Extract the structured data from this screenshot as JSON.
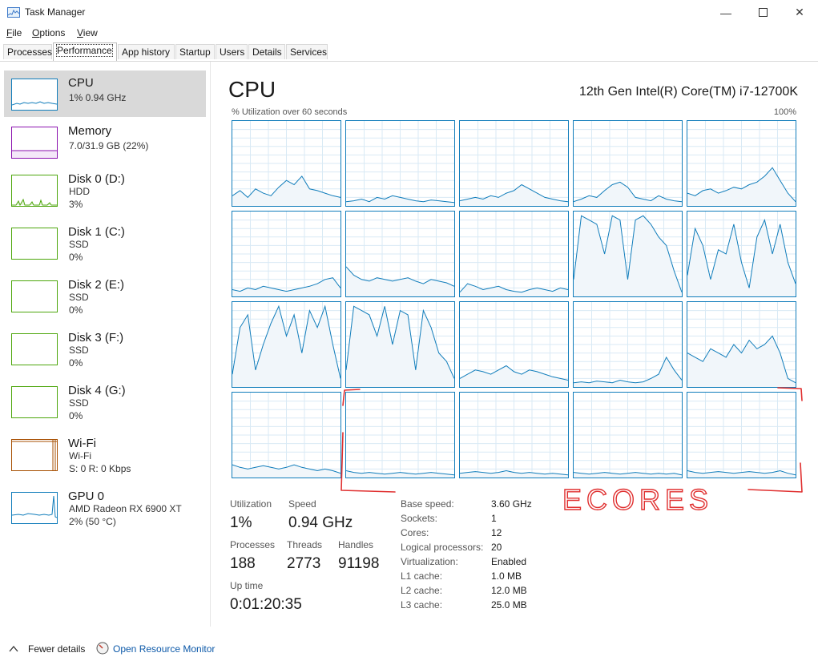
{
  "window": {
    "title": "Task Manager"
  },
  "menu": [
    "File",
    "Options",
    "View"
  ],
  "tabs": [
    "Processes",
    "Performance",
    "App history",
    "Startup",
    "Users",
    "Details",
    "Services"
  ],
  "sidebar": [
    {
      "name": "CPU",
      "sub1": "1% 0.94 GHz",
      "sub2": "",
      "color": "#117dbb"
    },
    {
      "name": "Memory",
      "sub1": "7.0/31.9 GB (22%)",
      "sub2": "",
      "color": "#8b12ae"
    },
    {
      "name": "Disk 0 (D:)",
      "sub1": "HDD",
      "sub2": "3%",
      "color": "#4da60c"
    },
    {
      "name": "Disk 1 (C:)",
      "sub1": "SSD",
      "sub2": "0%",
      "color": "#4da60c"
    },
    {
      "name": "Disk 2 (E:)",
      "sub1": "SSD",
      "sub2": "0%",
      "color": "#4da60c"
    },
    {
      "name": "Disk 3 (F:)",
      "sub1": "SSD",
      "sub2": "0%",
      "color": "#4da60c"
    },
    {
      "name": "Disk 4 (G:)",
      "sub1": "SSD",
      "sub2": "0%",
      "color": "#4da60c"
    },
    {
      "name": "Wi-Fi",
      "sub1": "Wi-Fi",
      "sub2": "S: 0 R: 0 Kbps",
      "color": "#a74f01"
    },
    {
      "name": "GPU 0",
      "sub1": "AMD Radeon RX 6900 XT",
      "sub2": "2% (50 °C)",
      "color": "#117dbb"
    }
  ],
  "main": {
    "title": "CPU",
    "processor": "12th Gen Intel(R) Core(TM) i7-12700K",
    "util_caption": "% Utilization over 60 seconds",
    "util_max": "100%"
  },
  "stats": {
    "utilization_label": "Utilization",
    "utilization": "1%",
    "speed_label": "Speed",
    "speed": "0.94 GHz",
    "processes_label": "Processes",
    "processes": "188",
    "threads_label": "Threads",
    "threads": "2773",
    "handles_label": "Handles",
    "handles": "91198",
    "uptime_label": "Up time",
    "uptime": "0:01:20:35"
  },
  "specs": [
    {
      "label": "Base speed:",
      "value": "3.60 GHz"
    },
    {
      "label": "Sockets:",
      "value": "1"
    },
    {
      "label": "Cores:",
      "value": "12"
    },
    {
      "label": "Logical processors:",
      "value": "20"
    },
    {
      "label": "Virtualization:",
      "value": "Enabled"
    },
    {
      "label": "L1 cache:",
      "value": "1.0 MB"
    },
    {
      "label": "L2 cache:",
      "value": "12.0 MB"
    },
    {
      "label": "L3 cache:",
      "value": "25.0 MB"
    }
  ],
  "footer": {
    "fewer_details": "Fewer details",
    "open_resource_monitor": "Open Resource Monitor"
  },
  "annotation": {
    "text": "ECORES",
    "color": "#e03030"
  },
  "cpu_graph_levels": [
    [
      0.12,
      0.18,
      0.1,
      0.2,
      0.15,
      0.12,
      0.22,
      0.3,
      0.25,
      0.35,
      0.2,
      0.18,
      0.15,
      0.12,
      0.1
    ],
    [
      0.05,
      0.06,
      0.08,
      0.05,
      0.1,
      0.08,
      0.12,
      0.1,
      0.08,
      0.06,
      0.05,
      0.07,
      0.06,
      0.05,
      0.04
    ],
    [
      0.06,
      0.08,
      0.1,
      0.08,
      0.12,
      0.1,
      0.15,
      0.18,
      0.25,
      0.2,
      0.15,
      0.1,
      0.08,
      0.06,
      0.05
    ],
    [
      0.05,
      0.08,
      0.12,
      0.1,
      0.18,
      0.25,
      0.28,
      0.22,
      0.1,
      0.08,
      0.06,
      0.12,
      0.08,
      0.06,
      0.05
    ],
    [
      0.15,
      0.12,
      0.18,
      0.2,
      0.15,
      0.18,
      0.22,
      0.2,
      0.25,
      0.28,
      0.35,
      0.45,
      0.3,
      0.15,
      0.05
    ],
    [
      0.08,
      0.06,
      0.1,
      0.08,
      0.12,
      0.1,
      0.08,
      0.06,
      0.08,
      0.1,
      0.12,
      0.15,
      0.2,
      0.22,
      0.1
    ],
    [
      0.35,
      0.25,
      0.2,
      0.18,
      0.22,
      0.2,
      0.18,
      0.2,
      0.22,
      0.18,
      0.15,
      0.2,
      0.18,
      0.16,
      0.12
    ],
    [
      0.05,
      0.15,
      0.12,
      0.08,
      0.1,
      0.12,
      0.08,
      0.06,
      0.05,
      0.08,
      0.1,
      0.08,
      0.06,
      0.1,
      0.08
    ],
    [
      0.2,
      0.95,
      0.9,
      0.85,
      0.5,
      0.95,
      0.9,
      0.2,
      0.9,
      0.95,
      0.85,
      0.7,
      0.6,
      0.3,
      0.05
    ],
    [
      0.25,
      0.8,
      0.6,
      0.2,
      0.55,
      0.5,
      0.85,
      0.4,
      0.1,
      0.7,
      0.9,
      0.5,
      0.85,
      0.4,
      0.15
    ],
    [
      0.15,
      0.7,
      0.85,
      0.2,
      0.5,
      0.75,
      0.95,
      0.6,
      0.85,
      0.4,
      0.9,
      0.7,
      0.95,
      0.5,
      0.1
    ],
    [
      0.2,
      0.95,
      0.9,
      0.85,
      0.6,
      0.95,
      0.5,
      0.9,
      0.85,
      0.2,
      0.9,
      0.7,
      0.4,
      0.3,
      0.1
    ],
    [
      0.1,
      0.15,
      0.2,
      0.18,
      0.15,
      0.2,
      0.25,
      0.18,
      0.15,
      0.2,
      0.18,
      0.15,
      0.12,
      0.1,
      0.08
    ],
    [
      0.05,
      0.06,
      0.05,
      0.07,
      0.06,
      0.05,
      0.08,
      0.06,
      0.05,
      0.06,
      0.1,
      0.15,
      0.35,
      0.2,
      0.08
    ],
    [
      0.4,
      0.35,
      0.3,
      0.45,
      0.4,
      0.35,
      0.5,
      0.4,
      0.55,
      0.45,
      0.5,
      0.6,
      0.4,
      0.1,
      0.05
    ],
    [
      0.15,
      0.12,
      0.1,
      0.12,
      0.14,
      0.12,
      0.1,
      0.12,
      0.15,
      0.12,
      0.1,
      0.08,
      0.1,
      0.08,
      0.05
    ],
    [
      0.08,
      0.06,
      0.05,
      0.06,
      0.05,
      0.04,
      0.05,
      0.06,
      0.05,
      0.04,
      0.05,
      0.06,
      0.05,
      0.04,
      0.03
    ],
    [
      0.05,
      0.06,
      0.07,
      0.06,
      0.05,
      0.06,
      0.08,
      0.06,
      0.05,
      0.06,
      0.05,
      0.04,
      0.05,
      0.04,
      0.03
    ],
    [
      0.06,
      0.05,
      0.04,
      0.05,
      0.06,
      0.05,
      0.04,
      0.05,
      0.06,
      0.05,
      0.04,
      0.05,
      0.04,
      0.05,
      0.03
    ],
    [
      0.08,
      0.06,
      0.05,
      0.06,
      0.07,
      0.06,
      0.05,
      0.06,
      0.07,
      0.06,
      0.05,
      0.06,
      0.08,
      0.05,
      0.03
    ]
  ]
}
